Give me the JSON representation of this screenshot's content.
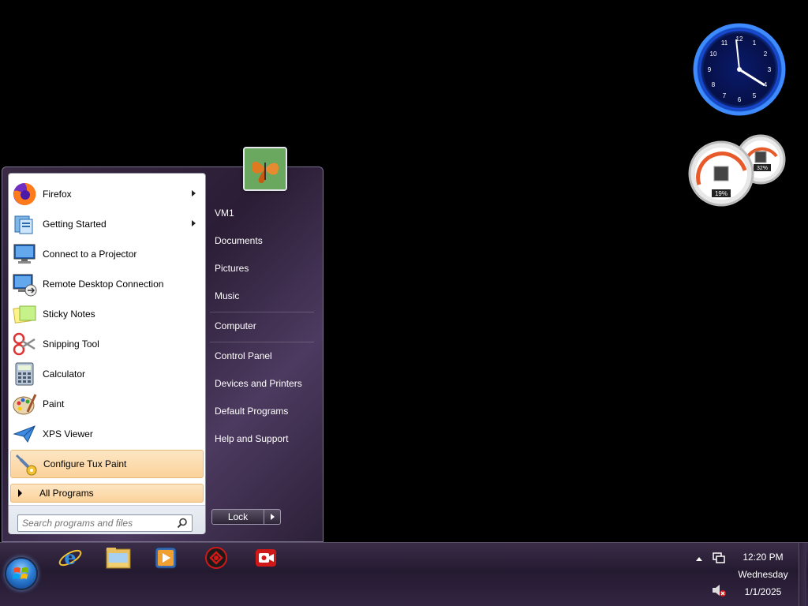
{
  "start_menu": {
    "programs": [
      {
        "label": "Firefox",
        "icon": "firefox-icon",
        "submenu": true
      },
      {
        "label": "Getting Started",
        "icon": "getting-started-icon",
        "submenu": true
      },
      {
        "label": "Connect to a Projector",
        "icon": "projector-icon",
        "submenu": false
      },
      {
        "label": "Remote Desktop Connection",
        "icon": "remote-desktop-icon",
        "submenu": false
      },
      {
        "label": "Sticky Notes",
        "icon": "sticky-notes-icon",
        "submenu": false
      },
      {
        "label": "Snipping Tool",
        "icon": "snipping-tool-icon",
        "submenu": false
      },
      {
        "label": "Calculator",
        "icon": "calculator-icon",
        "submenu": false
      },
      {
        "label": "Paint",
        "icon": "paint-icon",
        "submenu": false
      },
      {
        "label": "XPS Viewer",
        "icon": "xps-viewer-icon",
        "submenu": false
      },
      {
        "label": "Configure Tux Paint",
        "icon": "tux-paint-config-icon",
        "submenu": false,
        "highlighted": true
      }
    ],
    "all_programs_label": "All Programs",
    "search_placeholder": "Search programs and files",
    "right_items": [
      "VM1",
      "Documents",
      "Pictures",
      "Music",
      "Computer",
      "Control Panel",
      "Devices and Printers",
      "Default Programs",
      "Help and Support"
    ],
    "lock_label": "Lock"
  },
  "taskbar": {
    "pinned": [
      "internet-explorer-icon",
      "file-explorer-icon",
      "media-player-icon",
      "red-app-icon",
      "screen-recorder-icon"
    ],
    "tray": {
      "time": "12:20 PM",
      "day": "Wednesday",
      "date": "1/1/2025"
    }
  },
  "gadgets": {
    "cpu_meter": {
      "cpu_percent": "19%",
      "memory_percent": "32%"
    }
  },
  "colors": {
    "menu_highlight": "#fbd29a",
    "clock_ring": "#1f6dff"
  }
}
